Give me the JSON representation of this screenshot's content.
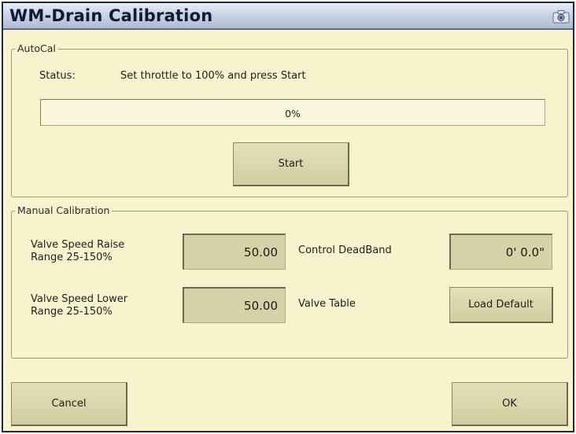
{
  "window": {
    "title": "WM-Drain Calibration",
    "camera_icon": "camera-icon"
  },
  "autocal": {
    "legend": "AutoCal",
    "status_label": "Status:",
    "status_text": "Set throttle to 100% and press Start",
    "progress_text": "0%",
    "progress_value": 0,
    "start_label": "Start"
  },
  "manual": {
    "legend": "Manual Calibration",
    "raise_label_1": "Valve Speed Raise",
    "raise_label_2": "Range 25-150%",
    "raise_value": "50.00",
    "lower_label_1": "Valve Speed Lower",
    "lower_label_2": "Range 25-150%",
    "lower_value": "50.00",
    "deadband_label": "Control DeadBand",
    "deadband_value": "0' 0.0\"",
    "valve_table_label": "Valve Table",
    "load_default_label": "Load Default"
  },
  "footer": {
    "cancel_label": "Cancel",
    "ok_label": "OK"
  }
}
